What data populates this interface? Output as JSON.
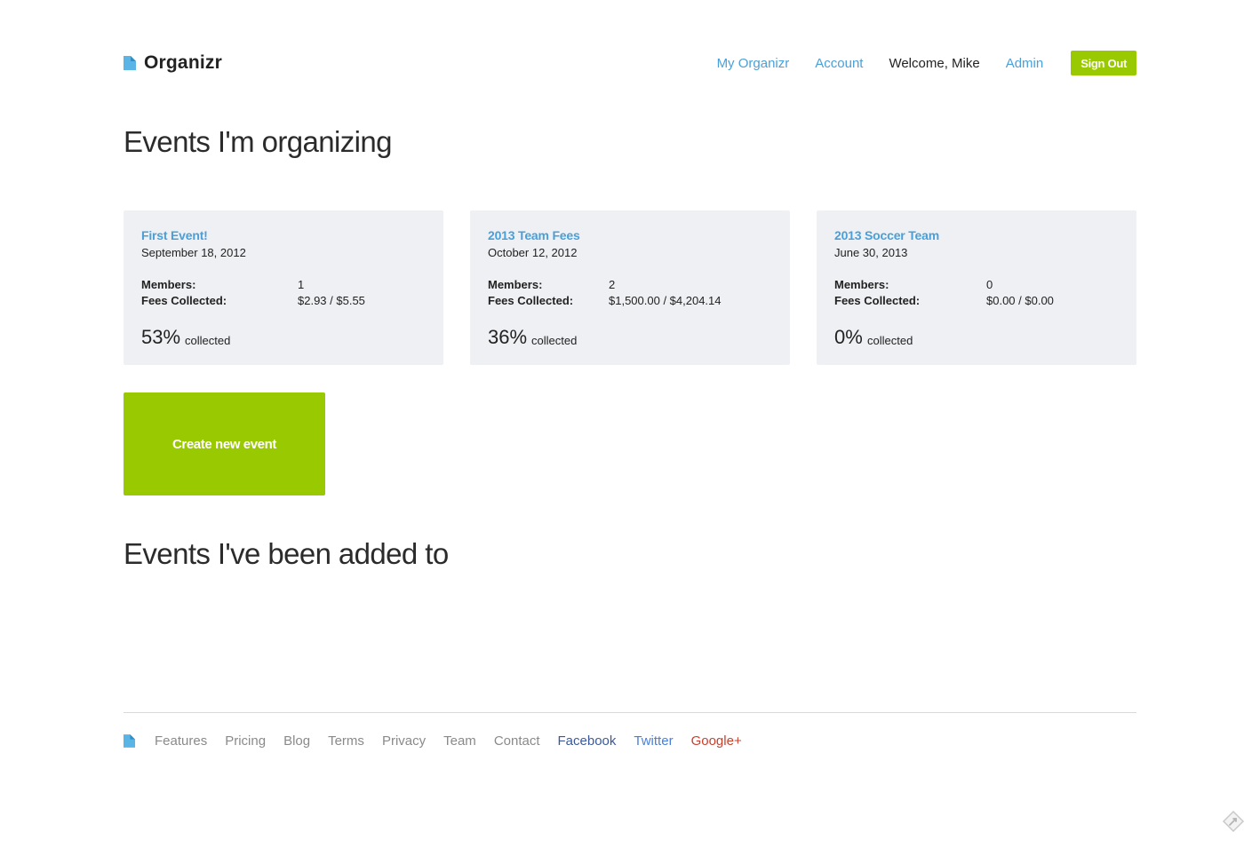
{
  "header": {
    "brand": "Organizr",
    "nav": {
      "my_organizr": "My Organizr",
      "account": "Account",
      "welcome": "Welcome, Mike",
      "admin": "Admin",
      "sign_out": "Sign Out"
    }
  },
  "organizing": {
    "heading": "Events I'm organizing",
    "labels": {
      "members": "Members:",
      "fees": "Fees Collected:",
      "collected": "collected"
    },
    "events": [
      {
        "title": "First Event!",
        "date": "September 18, 2012",
        "members": "1",
        "fees": "$2.93 / $5.55",
        "percent": "53%"
      },
      {
        "title": "2013 Team Fees",
        "date": "October 12, 2012",
        "members": "2",
        "fees": "$1,500.00 / $4,204.14",
        "percent": "36%"
      },
      {
        "title": "2013 Soccer Team",
        "date": "June 30, 2013",
        "members": "0",
        "fees": "$0.00 / $0.00",
        "percent": "0%"
      }
    ],
    "create_button": "Create new event"
  },
  "added": {
    "heading": "Events I've been added to"
  },
  "footer": {
    "links": [
      "Features",
      "Pricing",
      "Blog",
      "Terms",
      "Privacy",
      "Team",
      "Contact"
    ],
    "social": {
      "facebook": "Facebook",
      "twitter": "Twitter",
      "google": "Google+"
    }
  },
  "colors": {
    "link_blue": "#4a9fd8",
    "accent_green": "#99c900",
    "card_bg": "#eef0f3",
    "logo_blue": "#5ab4e5",
    "facebook": "#3b5998",
    "twitter": "#4a7fd8",
    "google": "#c8402e"
  },
  "icons": {
    "logo": "document-corner-icon",
    "corner": "pen-nib-icon"
  }
}
